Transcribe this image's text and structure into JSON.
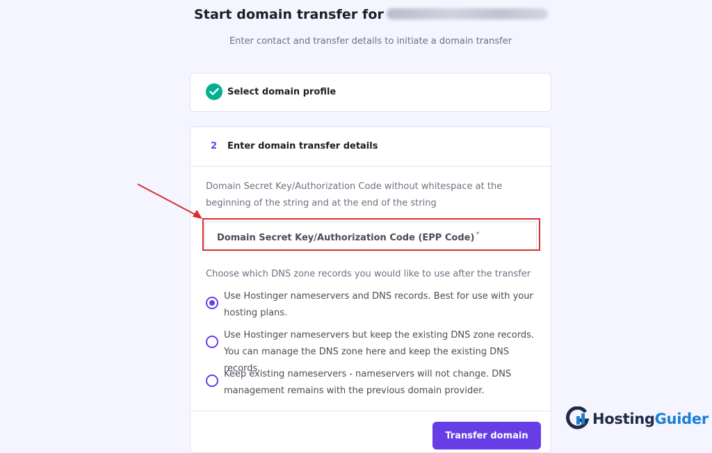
{
  "header": {
    "title": "Start domain transfer for",
    "subtitle": "Enter contact and transfer details to initiate a domain transfer"
  },
  "steps": [
    {
      "label": "Select domain profile",
      "status": "completed",
      "icon": "check-icon"
    },
    {
      "number": "2",
      "label": "Enter domain transfer details",
      "status": "active"
    }
  ],
  "transfer_form": {
    "help_text": "Domain Secret Key/Authorization Code without whitespace at the beginning of the string and at the end of the string",
    "epp_placeholder": "Domain Secret Key/Authorization Code (EPP Code)",
    "required_marker": "*",
    "dns_question": "Choose which DNS zone records you would like to use after the transfer",
    "dns_options": [
      {
        "label": "Use Hostinger nameservers and DNS records. Best for use with your hosting plans.",
        "selected": true
      },
      {
        "label": "Use Hostinger nameservers but keep the existing DNS zone records. You can manage the DNS zone here and keep the existing DNS records.",
        "selected": false
      },
      {
        "label": "Keep existing nameservers - nameservers will not change. DNS management remains with the previous domain provider.",
        "selected": false
      }
    ],
    "submit_label": "Transfer domain"
  },
  "watermark": {
    "part1": "Hosting",
    "part2": "Guider"
  },
  "colors": {
    "accent": "#673de6",
    "success": "#00b090",
    "annotation": "#d92d2d",
    "background": "#f4f5ff"
  }
}
